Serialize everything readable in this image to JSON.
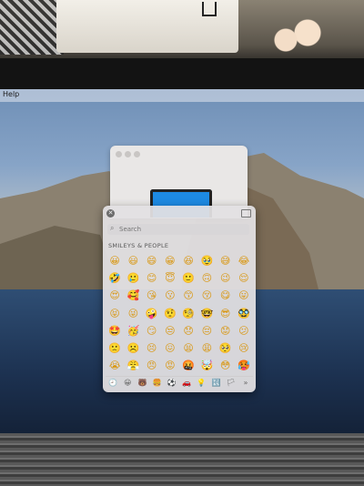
{
  "screen": {
    "menubar": {
      "help_label": "Help"
    }
  },
  "emoji_picker": {
    "close_icon": "close-icon",
    "sidebar_icon": "sidebar-toggle-icon",
    "search": {
      "placeholder": "Search",
      "icon": "search-icon"
    },
    "section_title": "SMILEYS & PEOPLE",
    "rows": [
      [
        "😀",
        "😃",
        "😄",
        "😁",
        "😆",
        "🥹",
        "😅",
        "😂"
      ],
      [
        "🤣",
        "🥲",
        "😊",
        "😇",
        "🙂",
        "🙃",
        "😉",
        "😌"
      ],
      [
        "😍",
        "🥰",
        "😘",
        "😗",
        "😙",
        "😚",
        "😋",
        "😛"
      ],
      [
        "😝",
        "😜",
        "🤪",
        "🤨",
        "🧐",
        "🤓",
        "😎",
        "🥸"
      ],
      [
        "🤩",
        "🥳",
        "😏",
        "😒",
        "😞",
        "😔",
        "😟",
        "😕"
      ],
      [
        "🙁",
        "☹️",
        "😣",
        "😖",
        "😫",
        "😩",
        "🥺",
        "😢"
      ],
      [
        "😭",
        "😤",
        "😠",
        "😡",
        "🤬",
        "🤯",
        "😳",
        "🥵"
      ]
    ],
    "category_tabs": [
      "🕘",
      "😀",
      "🐻",
      "🍔",
      "⚽",
      "🚗",
      "💡",
      "🔣",
      "🏳",
      "»"
    ]
  }
}
